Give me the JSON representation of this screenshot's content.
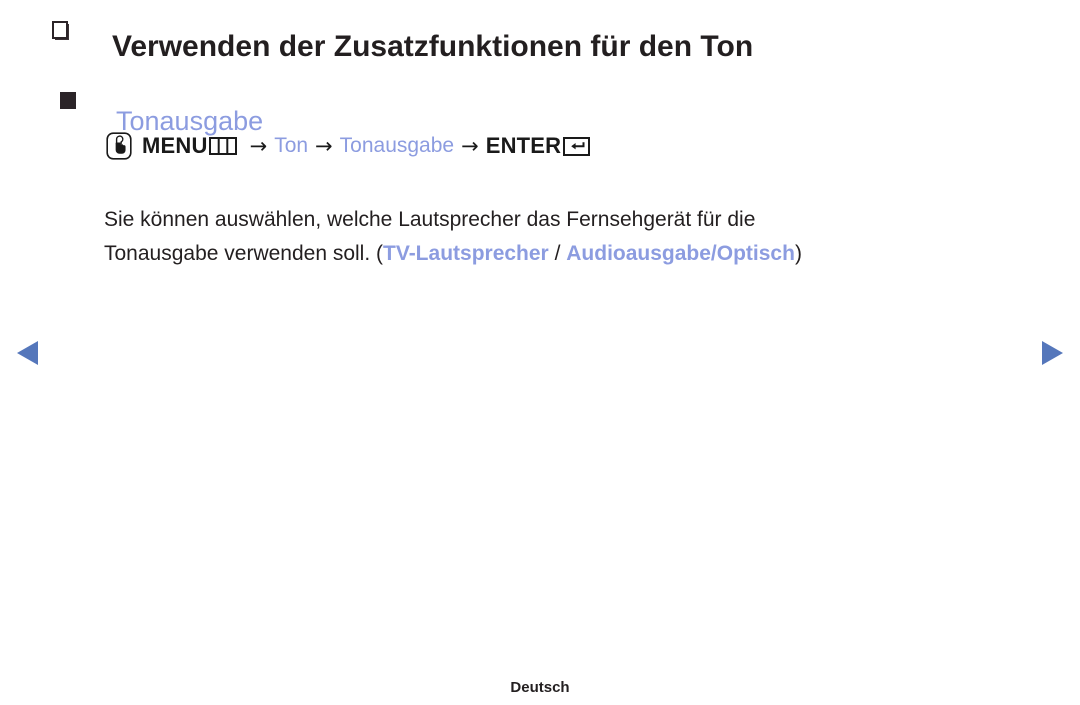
{
  "page": {
    "title": "Verwenden der Zusatzfunktionen für den Ton",
    "title_bullet_icon": "hollow-square-bullet-icon"
  },
  "section": {
    "bullet_icon": "filled-square-bullet-icon",
    "heading": "Tonausgabe",
    "heading_color": "#8c9ce0"
  },
  "menu_path": {
    "touch_icon": "hand-press-button-icon",
    "menu_label": "MENU",
    "menu_icon": "menu-grid-icon",
    "arrow": "→",
    "step1": "Ton",
    "step2": "Tonausgabe",
    "enter_label": "ENTER",
    "enter_icon": "enter-return-key-icon"
  },
  "body": {
    "line1": "Sie können auswählen, welche Lautsprecher das Fernsehgerät für die",
    "line2_before": "Tonausgabe verwenden soll. (",
    "option1": "TV-Lautsprecher",
    "separator": " / ",
    "option2": "Audioausgabe/Optisch",
    "line2_after": ")"
  },
  "navigation": {
    "prev_icon": "triangle-left-icon",
    "next_icon": "triangle-right-icon",
    "arrow_color": "#5577bb"
  },
  "footer": {
    "language": "Deutsch"
  }
}
